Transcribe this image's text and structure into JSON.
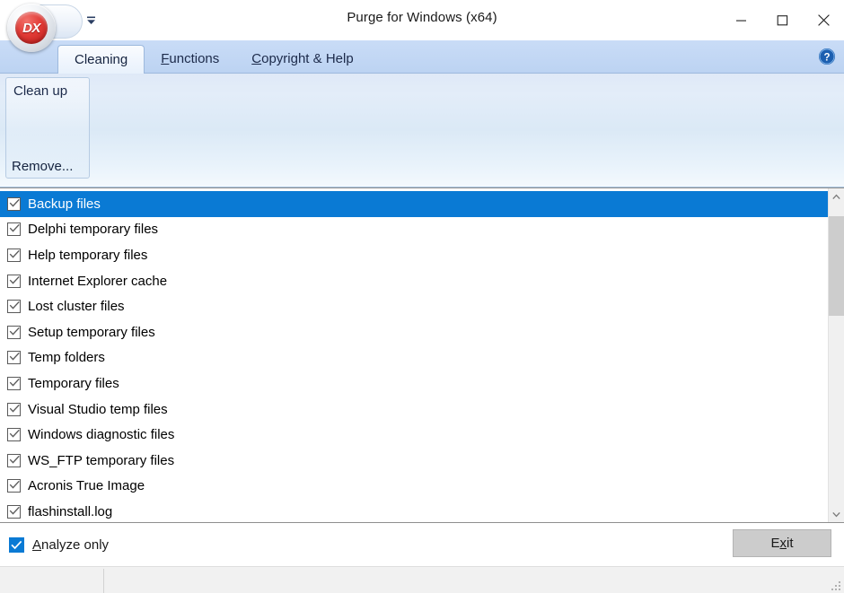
{
  "window": {
    "title": "Purge for Windows (x64)",
    "logo_text": "DX",
    "logo_name": "app-orb-logo",
    "controls": {
      "minimize": "minimize-icon",
      "maximize": "maximize-icon",
      "close": "close-icon"
    },
    "qat_dropdown": "customize-quick-access-toolbar-icon"
  },
  "tabs": [
    {
      "label": "Cleaning",
      "accel": "",
      "active": true
    },
    {
      "label": "Functions",
      "accel": "F",
      "active": false
    },
    {
      "label": "Copyright & Help",
      "accel": "C",
      "active": false
    }
  ],
  "help_button": {
    "icon": "help-question-icon",
    "glyph": "?"
  },
  "ribbon": {
    "group": {
      "title": "Clean up",
      "remove_label": "Remove..."
    }
  },
  "list": {
    "items": [
      {
        "label": "Backup files",
        "checked": true,
        "selected": true
      },
      {
        "label": "Delphi temporary files",
        "checked": true,
        "selected": false
      },
      {
        "label": "Help temporary files",
        "checked": true,
        "selected": false
      },
      {
        "label": "Internet Explorer cache",
        "checked": true,
        "selected": false
      },
      {
        "label": "Lost cluster files",
        "checked": true,
        "selected": false
      },
      {
        "label": "Setup temporary files",
        "checked": true,
        "selected": false
      },
      {
        "label": "Temp folders",
        "checked": true,
        "selected": false
      },
      {
        "label": "Temporary files",
        "checked": true,
        "selected": false
      },
      {
        "label": "Visual Studio temp files",
        "checked": true,
        "selected": false
      },
      {
        "label": "Windows diagnostic files",
        "checked": true,
        "selected": false
      },
      {
        "label": "WS_FTP temporary files",
        "checked": true,
        "selected": false
      },
      {
        "label": "Acronis True Image",
        "checked": true,
        "selected": false
      },
      {
        "label": "flashinstall.log",
        "checked": true,
        "selected": false
      }
    ],
    "scrollbar": {
      "up_icon": "scroll-up-arrow-icon",
      "down_icon": "scroll-down-arrow-icon",
      "thumb_position_percent": 4,
      "thumb_size_percent": 33
    }
  },
  "footer": {
    "analyze_only": {
      "label": "Analyze only",
      "accel": "A",
      "checked": true
    },
    "exit_button": {
      "label": "Exit",
      "accel": "x"
    }
  },
  "status_bar": {
    "text": "",
    "resize_grip": "resize-grip-icon"
  },
  "colors": {
    "selection_blue": "#0a7ad4",
    "tab_strip_blue": "#c2d7f4",
    "logo_red": "#e23b36",
    "button_gray": "#cccccc"
  }
}
